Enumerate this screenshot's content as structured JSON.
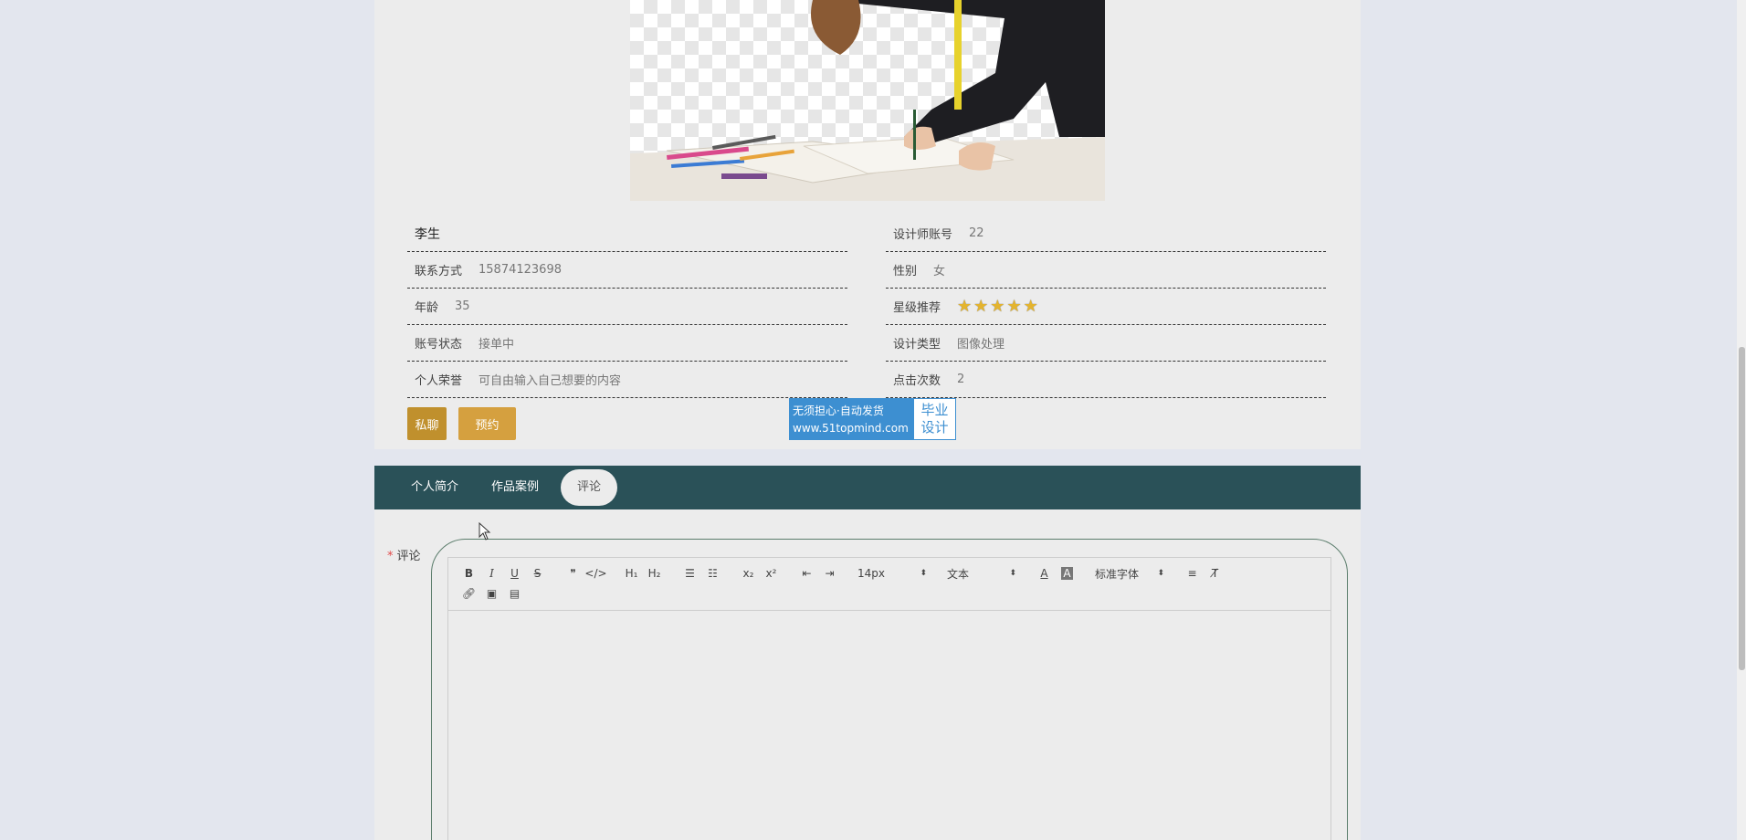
{
  "profile": {
    "name": "李生",
    "fields_left": [
      {
        "label": "联系方式",
        "value": "15874123698"
      },
      {
        "label": "年龄",
        "value": "35"
      },
      {
        "label": "账号状态",
        "value": "接单中"
      },
      {
        "label": "个人荣誉",
        "value": "可自由输入自己想要的内容"
      }
    ],
    "fields_right": [
      {
        "label": "设计师账号",
        "value": "22"
      },
      {
        "label": "性别",
        "value": "女"
      },
      {
        "label": "星级推荐",
        "stars": 5
      },
      {
        "label": "设计类型",
        "value": "图像处理"
      },
      {
        "label": "点击次数",
        "value": "2"
      }
    ]
  },
  "actions": {
    "chat_label": "私聊",
    "book_label": "预约"
  },
  "watermark": {
    "line1": "无须担心·自动发货",
    "line2": "www.51topmind.com",
    "right1": "毕业",
    "right2": "设计"
  },
  "tabs": [
    {
      "label": "个人简介",
      "active": false
    },
    {
      "label": "作品案例",
      "active": false
    },
    {
      "label": "评论",
      "active": true
    }
  ],
  "comment": {
    "label": "评论",
    "required_mark": "*",
    "font_size": "14px",
    "block_format": "文本",
    "font_family": "标准字体"
  },
  "colors": {
    "tab_bar": "#2a5158",
    "chat_button": "#c0902d",
    "book_button": "#d5a03f",
    "star": "#e4b42e"
  }
}
